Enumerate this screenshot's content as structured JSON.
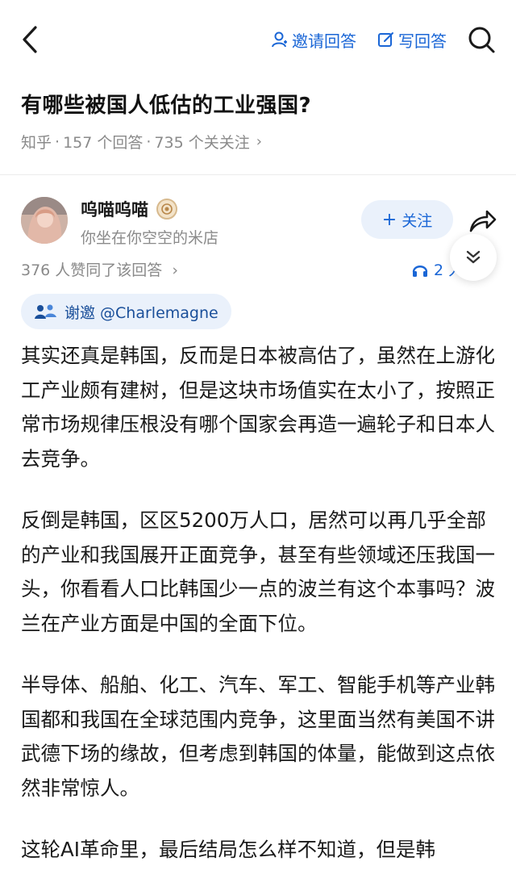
{
  "header": {
    "invite_label": "邀请回答",
    "write_label": "写回答"
  },
  "question": {
    "title": "有哪些被国人低估的工业强国?",
    "source": "知乎",
    "answers_count": "157 个回答",
    "followers_count": "735 个关关注"
  },
  "author": {
    "name": "呜喵呜喵",
    "bio": "你坐在你空空的米店"
  },
  "actions": {
    "follow_label": "关注",
    "likes_text": "376 人赞同了该回答",
    "audio_text": "2 人 立"
  },
  "invite_chip": {
    "label": "谢邀 @Charlemagne"
  },
  "answer": {
    "paragraphs": [
      "其实还真是韩国，反而是日本被高估了，虽然在上游化工产业颇有建树，但是这块市场值实在太小了，按照正常市场规律压根没有哪个国家会再造一遍轮子和日本人去竞争。",
      "反倒是韩国，区区5200万人口，居然可以再几乎全部的产业和我国展开正面竞争，甚至有些领域还压我国一头，你看看人口比韩国少一点的波兰有这个本事吗？波兰在产业方面是中国的全面下位。",
      "半导体、船舶、化工、汽车、军工、智能手机等产业韩国都和我国在全球范围内竞争，这里面当然有美国不讲武德下场的缘故，但考虑到韩国的体量，能做到这点依然非常惊人。",
      "这轮AI革命里，最后结局怎么样不知道，但是韩"
    ]
  },
  "colors": {
    "accent": "#1a66d6",
    "muted": "#8a8a8a",
    "chip_bg": "#eaf1fb"
  },
  "icons": [
    "back-arrow-icon",
    "person-icon",
    "edit-icon",
    "search-icon",
    "badge-icon",
    "share-icon",
    "headphone-icon",
    "double-chevron-down-icon",
    "group-icon"
  ]
}
